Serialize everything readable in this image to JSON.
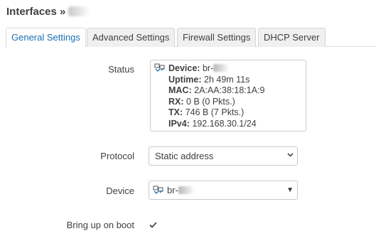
{
  "header": {
    "title": "Interfaces »"
  },
  "tabs": [
    {
      "label": "General Settings",
      "active": true
    },
    {
      "label": "Advanced Settings",
      "active": false
    },
    {
      "label": "Firewall Settings",
      "active": false
    },
    {
      "label": "DHCP Server",
      "active": false
    }
  ],
  "status": {
    "label": "Status",
    "device_key": "Device:",
    "device_value": "br-",
    "uptime_key": "Uptime:",
    "uptime_value": "2h 49m 11s",
    "mac_key": "MAC:",
    "mac_value": "2A:AA:38:18:1A:9",
    "rx_key": "RX:",
    "rx_value": "0 B (0 Pkts.)",
    "tx_key": "TX:",
    "tx_value": "746 B (7 Pkts.)",
    "ipv4_key": "IPv4:",
    "ipv4_value": "192.168.30.1/24",
    "icon": "network-bridge-icon"
  },
  "protocol": {
    "label": "Protocol",
    "value": "Static address"
  },
  "device": {
    "label": "Device",
    "value": "br-",
    "icon": "network-bridge-icon"
  },
  "boot": {
    "label": "Bring up on boot",
    "checked": true
  },
  "colors": {
    "accent": "#1a6fb4",
    "text": "#404040",
    "border": "#cccccc"
  }
}
